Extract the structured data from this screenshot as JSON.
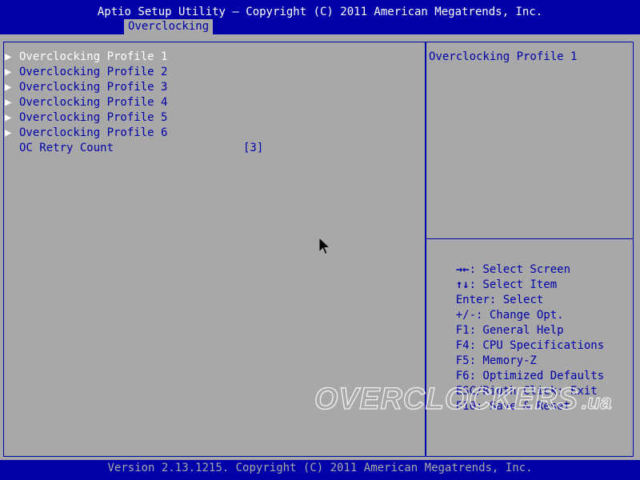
{
  "header": {
    "title": "Aptio Setup Utility – Copyright (C) 2011 American Megatrends, Inc.",
    "active_tab": "Overclocking"
  },
  "menu": {
    "items": [
      {
        "label": "Overclocking Profile 1",
        "icon": "submenu-arrow-icon",
        "selected": true
      },
      {
        "label": "Overclocking Profile 2",
        "icon": "submenu-arrow-icon"
      },
      {
        "label": "Overclocking Profile 3",
        "icon": "submenu-arrow-icon"
      },
      {
        "label": "Overclocking Profile 4",
        "icon": "submenu-arrow-icon"
      },
      {
        "label": "Overclocking Profile 5",
        "icon": "submenu-arrow-icon"
      },
      {
        "label": "Overclocking Profile 6",
        "icon": "submenu-arrow-icon"
      }
    ],
    "oc_retry": {
      "label": "OC Retry Count",
      "value": "[3]"
    }
  },
  "help": {
    "text": "Overclocking Profile 1"
  },
  "keys": [
    {
      "key": "→←",
      "desc": ": Select Screen"
    },
    {
      "key": "↑↓",
      "desc": ": Select Item"
    },
    {
      "key": "Enter",
      "desc": ": Select"
    },
    {
      "key": "+/-",
      "desc": ": Change Opt."
    },
    {
      "key": "F1",
      "desc": ": General Help"
    },
    {
      "key": "F4",
      "desc": ": CPU Specifications"
    },
    {
      "key": "F5",
      "desc": ": Memory-Z"
    },
    {
      "key": "F6",
      "desc": ": Optimized Defaults"
    },
    {
      "key": "ESC/Rigth Click",
      "desc": ": Exit"
    },
    {
      "key": "F10",
      "desc": ": Save & Reset"
    }
  ],
  "watermark": "OVERCLOCKERS.ua",
  "footer": {
    "text": "Version 2.13.1215. Copyright (C) 2011 American Megatrends, Inc."
  },
  "colors": {
    "bios_blue": "#0000a8",
    "bios_gray": "#a8a8a8",
    "text_white": "#ffffff"
  }
}
